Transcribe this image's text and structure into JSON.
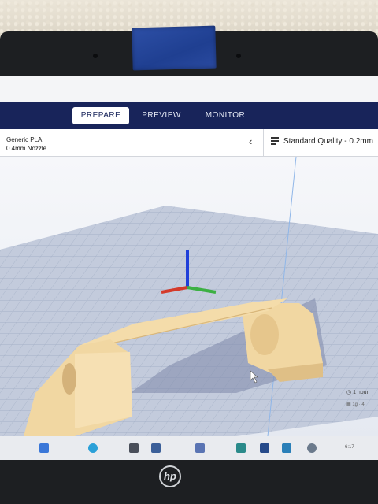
{
  "tabs": [
    {
      "label": "PREPARE",
      "active": true
    },
    {
      "label": "PREVIEW",
      "active": false
    },
    {
      "label": "MONITOR",
      "active": false
    }
  ],
  "printer": {
    "material": "Generic PLA",
    "nozzle": "0.4mm Nozzle"
  },
  "print_settings": {
    "quality": "Standard Quality - 0.2mm"
  },
  "estimate": {
    "time": "1 hour",
    "detail": "1g · 4"
  },
  "taskbar": {
    "clock": "6:17"
  },
  "device": {
    "brand": "hp"
  },
  "colors": {
    "app_bar": "#18245a",
    "model": "#f2d9a6",
    "build_plate": "#b9c3d6",
    "axis_x": "#d43a2a",
    "axis_y": "#3cb043",
    "axis_z": "#1f3fd9"
  },
  "icons": [
    "menu-lines-icon",
    "chevron-left-icon",
    "clock-icon",
    "weight-icon",
    "cursor-icon",
    "hp-logo-icon"
  ]
}
